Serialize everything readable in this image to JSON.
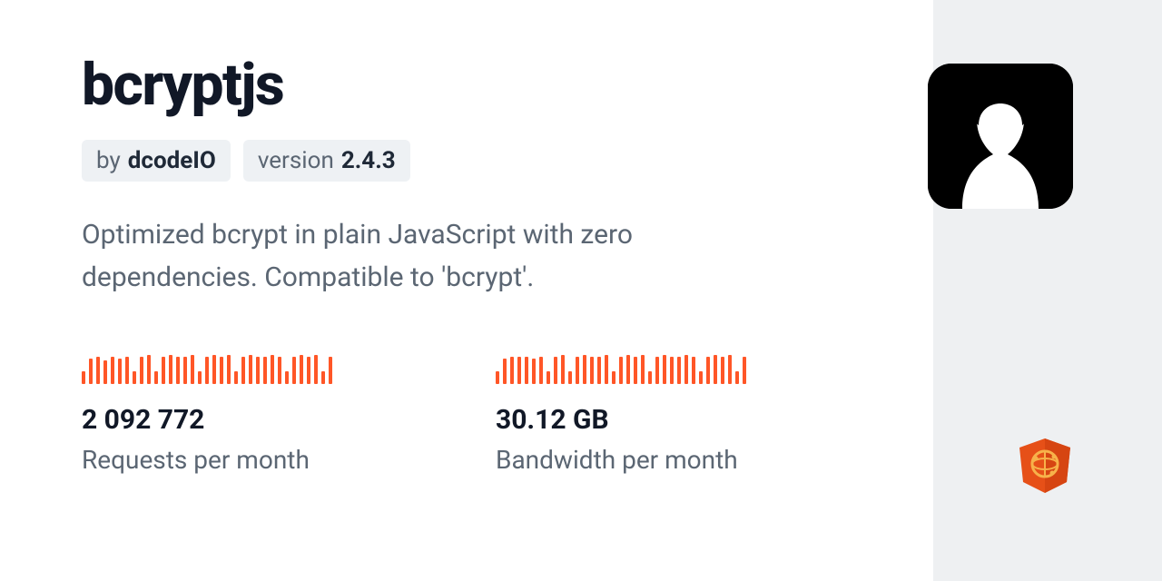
{
  "package": {
    "name": "bcryptjs",
    "author_prefix": "by",
    "author": "dcodeIO",
    "version_prefix": "version",
    "version": "2.4.3",
    "description": "Optimized bcrypt in plain JavaScript with zero dependencies. Compatible to 'bcrypt'."
  },
  "stats": {
    "requests": {
      "value": "2 092 772",
      "label": "Requests per month",
      "spark": [
        14,
        28,
        30,
        26,
        30,
        28,
        30,
        14,
        30,
        32,
        14,
        30,
        32,
        30,
        30,
        32,
        14,
        30,
        32,
        30,
        32,
        14,
        30,
        32,
        30,
        30,
        32,
        30,
        14,
        30,
        32,
        30,
        32,
        14,
        30
      ]
    },
    "bandwidth": {
      "value": "30.12 GB",
      "label": "Bandwidth per month",
      "spark": [
        14,
        28,
        30,
        30,
        30,
        28,
        30,
        14,
        30,
        32,
        14,
        30,
        32,
        30,
        30,
        32,
        14,
        30,
        32,
        30,
        32,
        14,
        30,
        32,
        30,
        30,
        32,
        30,
        14,
        30,
        32,
        30,
        32,
        14,
        30
      ]
    }
  }
}
